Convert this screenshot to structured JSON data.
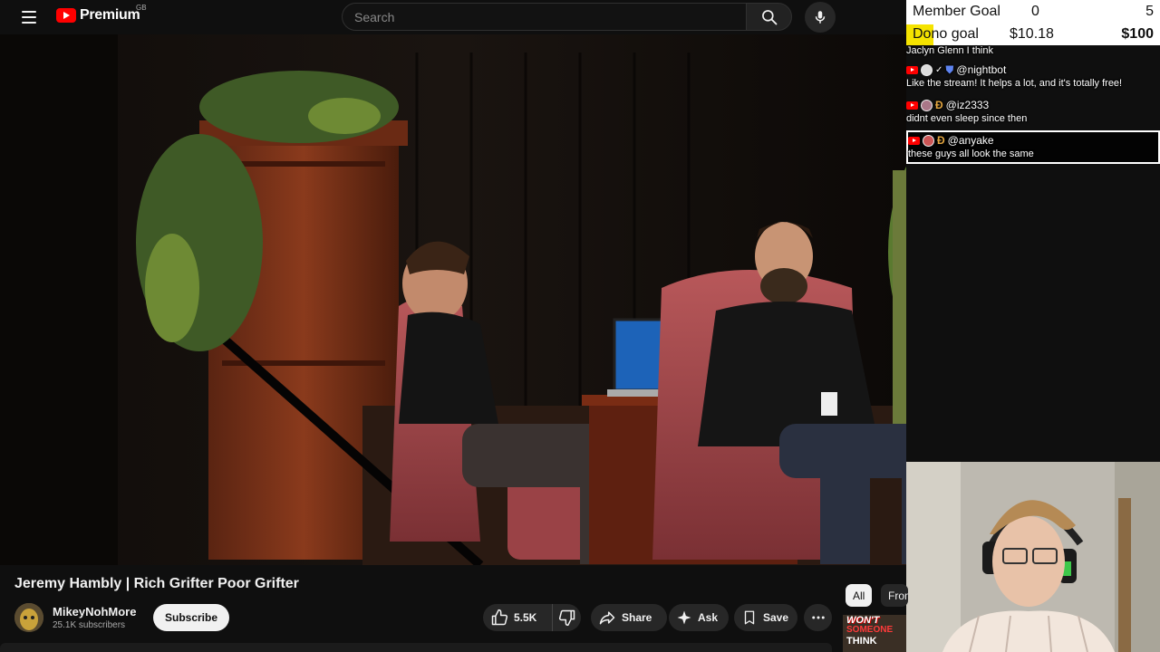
{
  "masthead": {
    "logo_text": "Premium",
    "region": "GB",
    "search_placeholder": "Search"
  },
  "overlay": {
    "member_goal": {
      "label": "Member Goal",
      "current": "0",
      "target": "5"
    },
    "dono_goal": {
      "label": "Dono goal",
      "current": "$10.18",
      "target": "$100"
    },
    "chat": [
      {
        "author": "",
        "text": "Jaclyn Glenn I think"
      },
      {
        "author": "@nightbot",
        "text": "Like the stream! It helps a lot, and it's totally free!"
      },
      {
        "author": "@iz2333",
        "text": "didnt even sleep since then"
      },
      {
        "author": "@anyake",
        "text": "these guys all look the same"
      }
    ]
  },
  "video": {
    "title": "Jeremy Hambly | Rich Grifter Poor Grifter"
  },
  "channel": {
    "name": "MikeyNohMore",
    "subscribers": "25.1K subscribers",
    "subscribe_label": "Subscribe"
  },
  "actions": {
    "like_count": "5.5K",
    "share_label": "Share",
    "ask_label": "Ask",
    "save_label": "Save"
  },
  "sidebar": {
    "chips": [
      "All",
      "From"
    ],
    "thumb_text": [
      "WON'T",
      "SOMEONE",
      "THINK"
    ]
  },
  "colors": {
    "youtube_red": "#ff0000",
    "dono_highlight": "#f5e300",
    "background": "#0f0f0f"
  }
}
